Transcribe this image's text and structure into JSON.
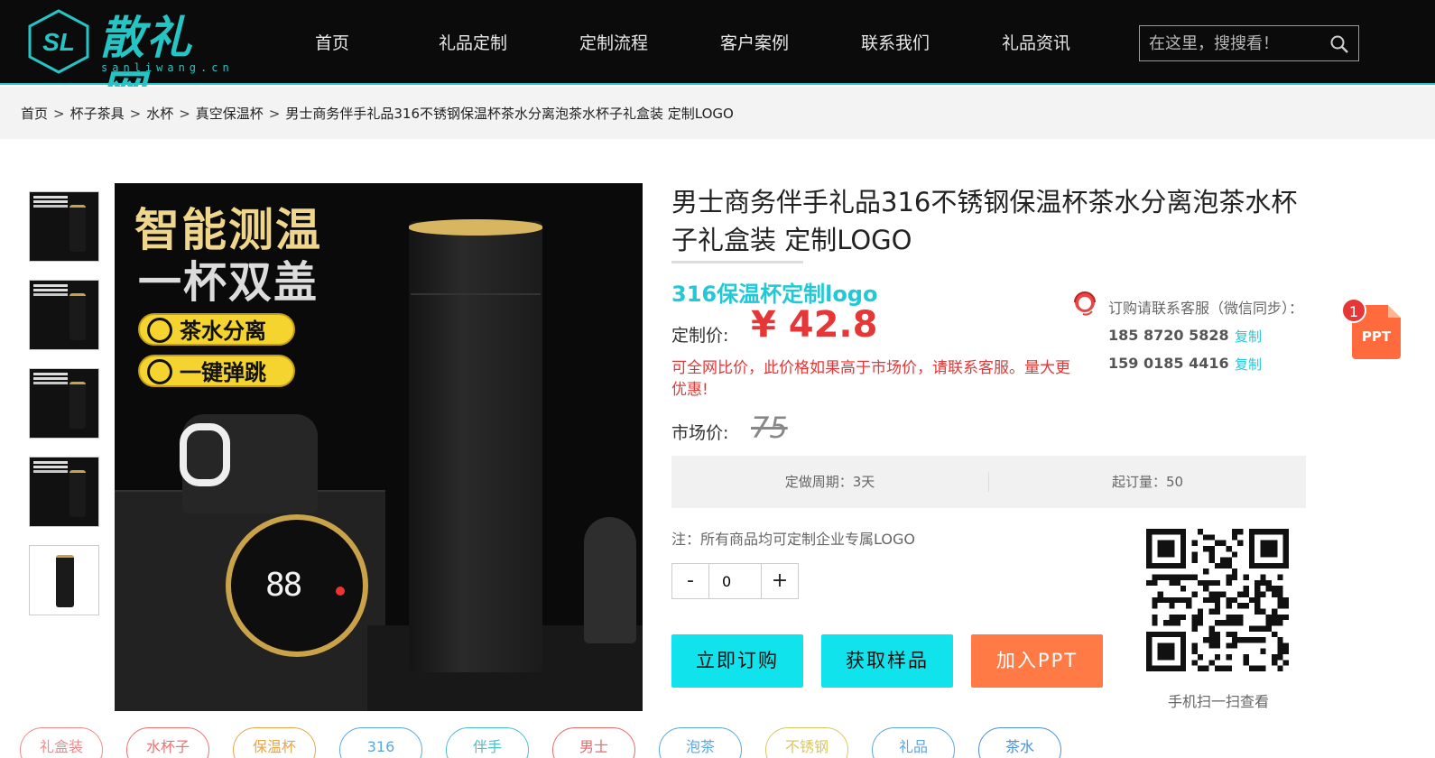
{
  "brand": {
    "logo_mark": "SL",
    "name": "散礼网",
    "domain": "sanliwang.cn"
  },
  "nav": [
    "首页",
    "礼品定制",
    "定制流程",
    "客户案例",
    "联系我们",
    "礼品资讯"
  ],
  "search": {
    "placeholder": "在这里，搜搜看！"
  },
  "breadcrumb": [
    "首页",
    "杯子茶具",
    "水杯",
    "真空保温杯",
    "男士商务伴手礼品316不锈钢保温杯茶水分离泡茶水杯子礼盒装 定制LOGO"
  ],
  "breadcrumb_sep": ">",
  "main_image": {
    "headline_1": "智能测温",
    "headline_2": "一杯双盖",
    "feature_1": "茶水分离",
    "feature_2": "一键弹跳",
    "display_digits": "88"
  },
  "product": {
    "title": "男士商务伴手礼品316不锈钢保温杯茶水分离泡茶水杯子礼盒装 定制LOGO",
    "subtitle": "316保温杯定制logo",
    "price_label": "定制价:",
    "price": "¥ 42.8",
    "notice": "可全网比价，此价格如果高于市场价，请联系客服。量大更优惠!",
    "market_label": "市场价:",
    "market_price": "75",
    "lead_time": "定做周期：3天",
    "min_order": "起订量：50",
    "note": "注：所有商品均可定制企业专属LOGO",
    "quantity": "0",
    "qty_minus": "-",
    "qty_plus": "+"
  },
  "service": {
    "caption": "订购请联系客服（微信同步）：",
    "phones": [
      "185 8720 5828",
      "159 0185 4416"
    ],
    "copy_label": "复制"
  },
  "actions": {
    "buy": "立即订购",
    "sample": "获取样品",
    "ppt": "加入PPT"
  },
  "qr_caption": "手机扫一扫查看",
  "ppt_float": {
    "label": "PPT",
    "count": "1"
  },
  "tags": [
    {
      "label": "礼盒装",
      "color": "#f08a8a"
    },
    {
      "label": "水杯子",
      "color": "#f07070"
    },
    {
      "label": "保温杯",
      "color": "#e8a64a"
    },
    {
      "label": "316",
      "color": "#5aa7e0"
    },
    {
      "label": "伴手",
      "color": "#4cc0c8"
    },
    {
      "label": "男士",
      "color": "#e86a6a"
    },
    {
      "label": "泡茶",
      "color": "#5aa7e0"
    },
    {
      "label": "不锈钢",
      "color": "#d8c860"
    },
    {
      "label": "礼品",
      "color": "#5aa7e0"
    },
    {
      "label": "茶水",
      "color": "#4c90d8"
    }
  ],
  "colors": {
    "accent": "#21c9d7",
    "price": "#e53737",
    "button_primary": "#11e3ec",
    "button_ppt": "#ff7a45",
    "header_bg": "#0b0b0b"
  }
}
